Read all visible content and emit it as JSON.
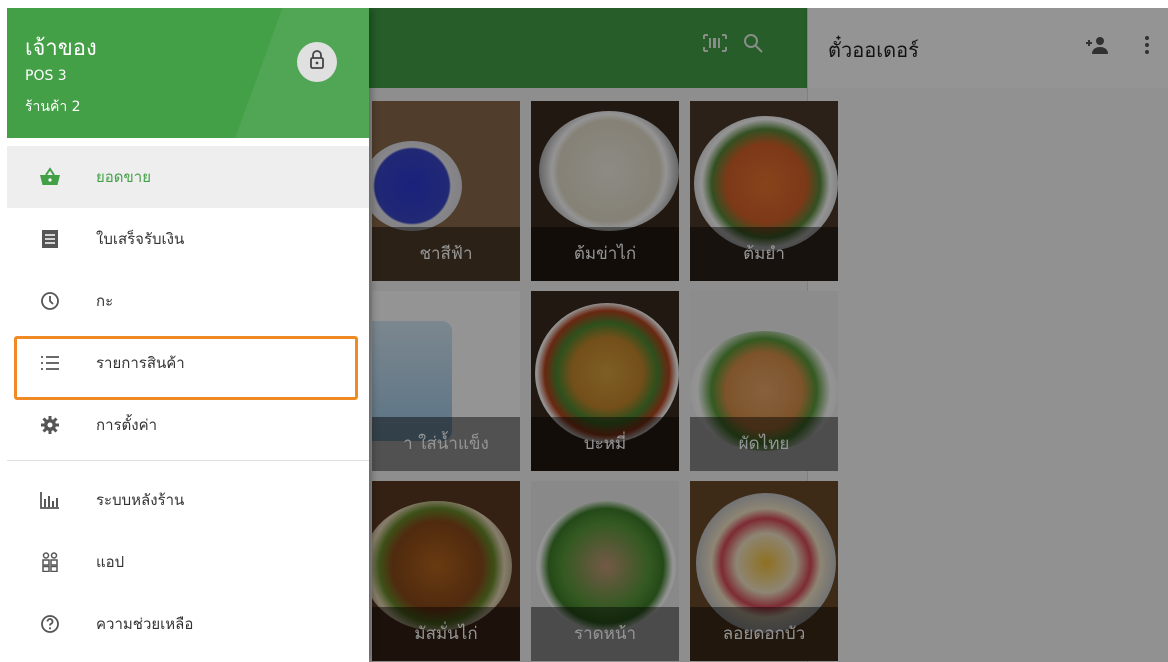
{
  "drawer": {
    "owner": "เจ้าของ",
    "pos": "POS 3",
    "store": "ร้านค้า 2",
    "items": [
      {
        "label": "ยอดขาย",
        "icon": "basket-icon"
      },
      {
        "label": "ใบเสร็จรับเงิน",
        "icon": "receipt-icon"
      },
      {
        "label": "กะ",
        "icon": "clock-icon"
      },
      {
        "label": "รายการสินค้า",
        "icon": "list-icon"
      },
      {
        "label": "การตั้งค่า",
        "icon": "gear-icon"
      },
      {
        "label": "ระบบหลังร้าน",
        "icon": "bar-chart-icon"
      },
      {
        "label": "แอป",
        "icon": "apps-icon"
      },
      {
        "label": "ความช่วยเหลือ",
        "icon": "help-icon"
      }
    ],
    "active_item": "ยอดขาย",
    "highlighted_item": "รายการสินค้า"
  },
  "ticket": {
    "title": "ตั๋วออเดอร์"
  },
  "products": [
    {
      "name": "ชาสีฟ้า"
    },
    {
      "name": "ต้มข่าไก่"
    },
    {
      "name": "ต้มยำ"
    },
    {
      "name": "า ใส่น้ำแข็ง"
    },
    {
      "name": "บะหมี่"
    },
    {
      "name": "ผัดไทย"
    },
    {
      "name": "มัสมั่นไก่"
    },
    {
      "name": "ราดหน้า"
    },
    {
      "name": "ลอยดอกบัว"
    }
  ],
  "colors": {
    "accent": "#43a047",
    "highlight": "#f08a24"
  }
}
